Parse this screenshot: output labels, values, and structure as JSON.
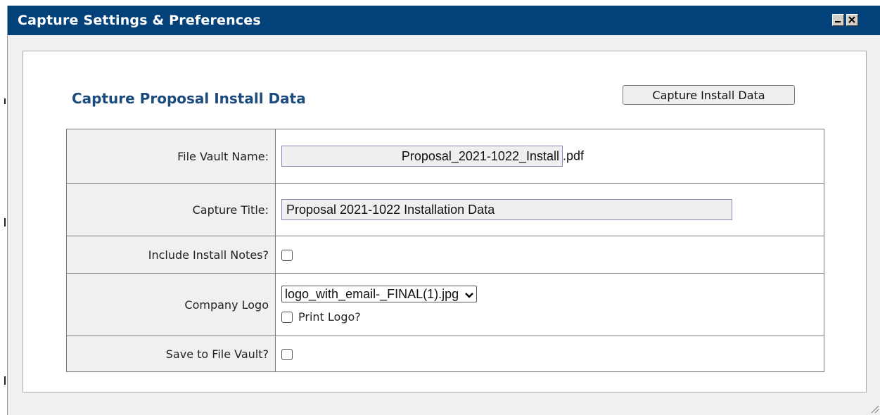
{
  "window": {
    "title": "Capture Settings & Preferences",
    "minimize_icon": "minimize-icon",
    "close_icon": "close-icon"
  },
  "section": {
    "title": "Capture Proposal Install Data",
    "capture_button_label": "Capture Install Data"
  },
  "form": {
    "file_vault_name": {
      "label": "File Vault Name:",
      "value": "Proposal_2021-1022_Install",
      "extension": ".pdf"
    },
    "capture_title": {
      "label": "Capture Title:",
      "value": "Proposal 2021-1022 Installation Data"
    },
    "include_install_notes": {
      "label": "Include Install Notes?",
      "checked": false
    },
    "company_logo": {
      "label": "Company Logo",
      "selected": "logo_with_email-_FINAL(1).jpg",
      "print_logo_label": "Print Logo?",
      "print_logo_checked": false
    },
    "save_to_file_vault": {
      "label": "Save to File Vault?",
      "checked": false
    }
  },
  "colors": {
    "titlebar": "#03417a",
    "section_title": "#1c4b7e",
    "label_bg": "#f0f0f0"
  }
}
